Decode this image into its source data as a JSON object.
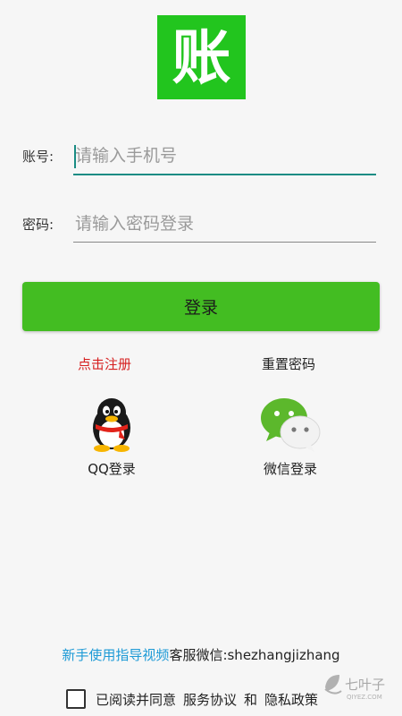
{
  "logo": {
    "char": "账",
    "bg": "#22c51e"
  },
  "account": {
    "label": "账号:",
    "placeholder": "请输入手机号",
    "value": ""
  },
  "password": {
    "label": "密码:",
    "placeholder": "请输入密码登录",
    "value": ""
  },
  "login_button": {
    "label": "登录",
    "color": "#43bd22"
  },
  "links": {
    "register": "点击注册",
    "reset": "重置密码"
  },
  "social": {
    "qq": {
      "label": "QQ登录",
      "icon": "qq-penguin-icon"
    },
    "wechat": {
      "label": "微信登录",
      "icon": "wechat-icon"
    }
  },
  "footer": {
    "guide": "新手使用指导视频",
    "service": "客服微信:shezhangjizhang",
    "agree_text": "已阅读并同意",
    "service_agreement": "服务协议",
    "and": "和",
    "privacy_policy": "隐私政策"
  },
  "watermark": {
    "text": "七叶子",
    "subtext": "QIYEZ.COM"
  }
}
